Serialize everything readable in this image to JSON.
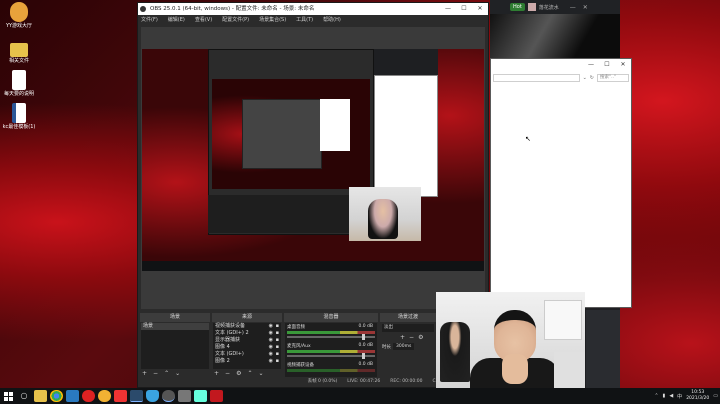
{
  "desktop": {
    "icons": [
      {
        "label": "YY游戏大厅",
        "icon": "yy-game-icon",
        "color": "#e8a23b"
      },
      {
        "label": "相关文件",
        "icon": "folder-icon",
        "color": "#e7c24b"
      },
      {
        "label": "每天要的说明",
        "icon": "document-icon",
        "color": "#ffffff"
      },
      {
        "label": "kc最佳模板(1)",
        "icon": "word-doc-icon",
        "color": "#2b5797"
      }
    ]
  },
  "obs": {
    "title": "OBS 25.0.1 (64-bit, windows) - 配置文件: 未命名 - 场景: 未命名",
    "menu": [
      "文件(F)",
      "编辑(E)",
      "查看(V)",
      "配置文件(P)",
      "场景集合(S)",
      "工具(T)",
      "帮助(H)"
    ],
    "docks": {
      "scenes": {
        "title": "场景",
        "items": [
          "场景"
        ]
      },
      "sources": {
        "title": "来源",
        "items": [
          "视频捕获设备",
          "文本 (GDI+) 2",
          "显示器捕获",
          "图像 4",
          "文本 (GDI+)",
          "图像 2",
          "图像"
        ]
      },
      "mixer": {
        "title": "混音器",
        "channels": [
          {
            "name": "桌面音频",
            "db": "0.0 dB"
          },
          {
            "name": "麦克风/Aux",
            "db": "0.0 dB"
          },
          {
            "name": "视频捕获设备",
            "db": "0.0 dB"
          }
        ]
      },
      "transitions": {
        "title": "场景过渡",
        "type": "淡出",
        "duration_label": "时长",
        "duration": "300ms"
      }
    },
    "status": {
      "dropped": "丢帧 0 (0.0%)",
      "live": "LIVE: 00:47:26",
      "rec": "REC: 00:00:00",
      "cpu": "CPU: 1.1%, 30.00 fps"
    }
  },
  "explorer": {
    "search_placeholder": "搜索\"..\""
  },
  "dark_app": {
    "badge": "Hot",
    "user": "落花流水"
  },
  "taskbar": {
    "icons": [
      {
        "name": "windows-logo-icon"
      },
      {
        "name": "search-icon",
        "color": "#3a3a3a"
      },
      {
        "name": "folder-icon",
        "color": "#e7c24b"
      },
      {
        "name": "chrome-icon",
        "color": "#4285f4"
      },
      {
        "name": "app-icon",
        "color": "#2a7ac0"
      },
      {
        "name": "netease-icon",
        "color": "#d22"
      },
      {
        "name": "game-icon",
        "color": "#f2b233"
      },
      {
        "name": "app-icon",
        "color": "#e33"
      },
      {
        "name": "steam-icon",
        "color": "#1b2838"
      },
      {
        "name": "shield-icon",
        "color": "#3aa3e0"
      },
      {
        "name": "obs-icon",
        "color": "#444"
      },
      {
        "name": "app-icon",
        "color": "#555"
      },
      {
        "name": "app-icon",
        "color": "#6fd"
      },
      {
        "name": "wps-icon",
        "color": "#c2181e"
      }
    ],
    "tray": {
      "lang": "中",
      "time": "10:53",
      "date": "2021/3/20"
    }
  }
}
